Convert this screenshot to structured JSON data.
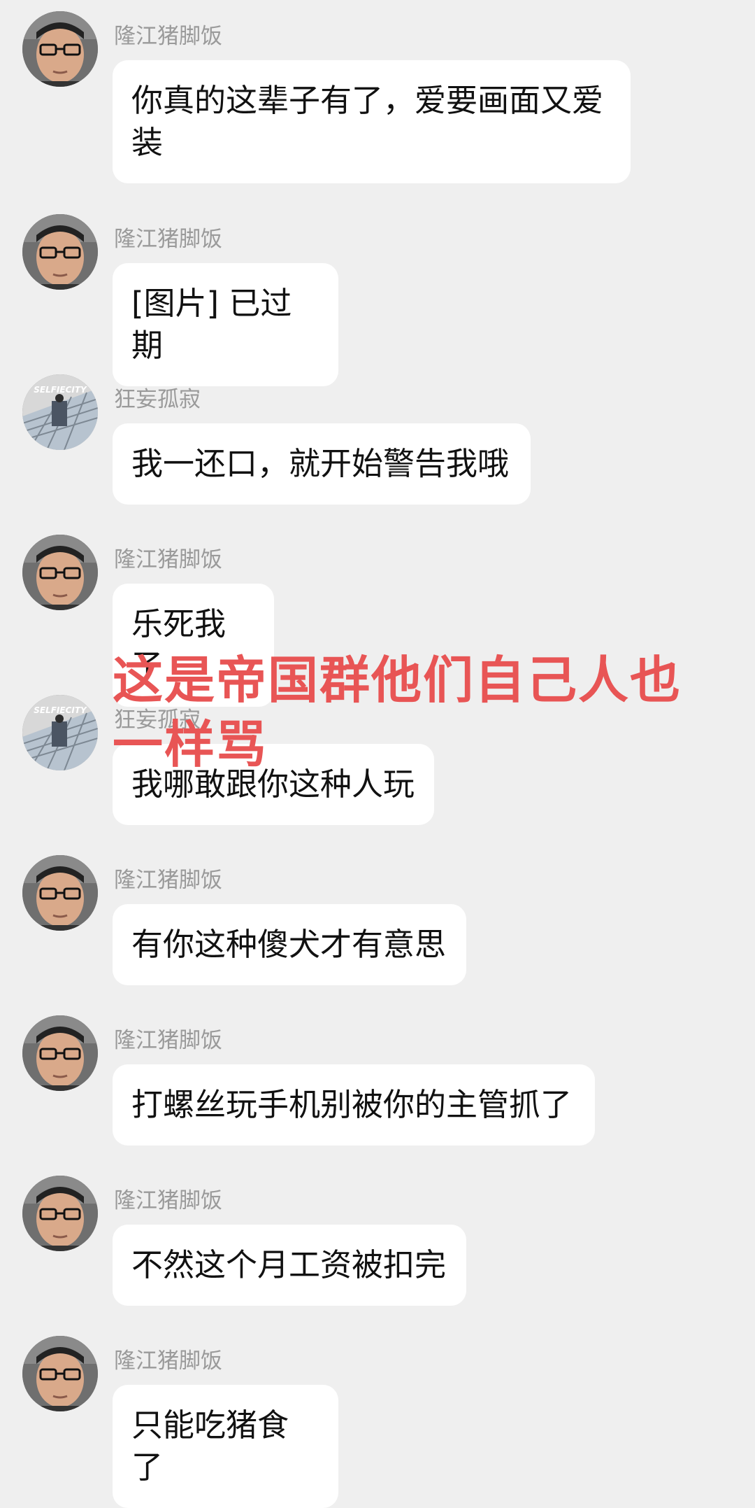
{
  "users": {
    "longjiang": {
      "name": "隆江猪脚饭",
      "avatar_icon": "man-with-glasses-avatar-icon"
    },
    "kuangwang": {
      "name": "狂妄孤寂",
      "avatar_icon": "selfiecity-photo-avatar-icon",
      "avatar_text": "SELFIECITY"
    }
  },
  "messages": [
    {
      "sender": "隆江猪脚饭",
      "text": "你真的这辈子有了，爱要画面又爱装"
    },
    {
      "sender": "隆江猪脚饭",
      "text": "[图片] 已过期"
    },
    {
      "sender": "狂妄孤寂",
      "text": "我一还口，就开始警告我哦"
    },
    {
      "sender": "隆江猪脚饭",
      "text": "乐死我了"
    },
    {
      "sender": "狂妄孤寂",
      "text": "我哪敢跟你这种人玩"
    },
    {
      "sender": "隆江猪脚饭",
      "text": "有你这种傻犬才有意思"
    },
    {
      "sender": "隆江猪脚饭",
      "text": "打螺丝玩手机别被你的主管抓了"
    },
    {
      "sender": "隆江猪脚饭",
      "text": "不然这个月工资被扣完"
    },
    {
      "sender": "隆江猪脚饭",
      "text": "只能吃猪食了"
    }
  ],
  "overlay_annotation": "这是帝国群他们自己人也一样骂",
  "colors": {
    "background": "#efefef",
    "bubble": "#ffffff",
    "name_text": "#9a9a9a",
    "annotation": "#e85555"
  }
}
